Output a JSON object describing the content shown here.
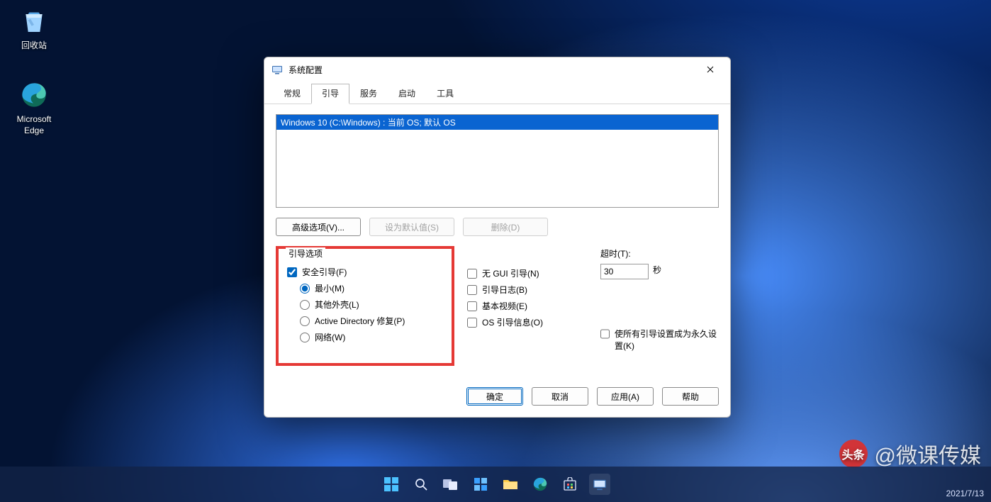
{
  "desktop": {
    "icons": {
      "recycle_bin": "回收站",
      "edge": "Microsoft\nEdge"
    }
  },
  "window": {
    "title": "系统配置",
    "tabs": [
      "常规",
      "引导",
      "服务",
      "启动",
      "工具"
    ],
    "active_tab": 1,
    "boot_list": {
      "selected": "Windows 10 (C:\\Windows) : 当前 OS; 默认 OS"
    },
    "buttons": {
      "advanced": "高级选项(V)...",
      "set_default": "设为默认值(S)",
      "delete": "删除(D)"
    },
    "group": {
      "legend": "引导选项",
      "safe_boot": "安全引导(F)",
      "radio_min": "最小(M)",
      "radio_altshell": "其他外壳(L)",
      "radio_ad": "Active Directory 修复(P)",
      "radio_net": "网络(W)"
    },
    "flags": {
      "no_gui": "无 GUI 引导(N)",
      "boot_log": "引导日志(B)",
      "base_video": "基本视频(E)",
      "os_info": "OS 引导信息(O)"
    },
    "timeout": {
      "label": "超时(T):",
      "value": "30",
      "unit": "秒"
    },
    "permanent": "使所有引导设置成为永久设置(K)",
    "footer": {
      "ok": "确定",
      "cancel": "取消",
      "apply": "应用(A)",
      "help": "帮助"
    }
  },
  "watermark": {
    "badge": "头条",
    "text": "@微课传媒"
  },
  "tray": {
    "date": "2021/7/13"
  }
}
